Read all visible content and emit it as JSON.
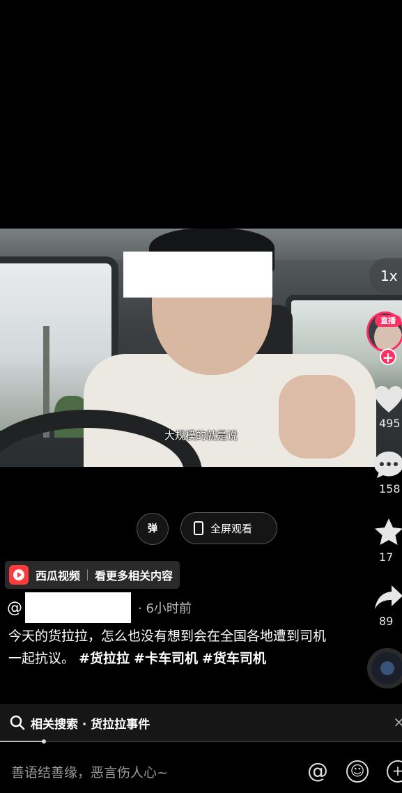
{
  "video": {
    "subtitle": "大规模的就是说",
    "speed_label": "1x"
  },
  "live": {
    "tag": "直播",
    "follow": "+"
  },
  "actions": {
    "like_count": "495",
    "comment_count": "158",
    "favorite_count": "17",
    "share_count": "89"
  },
  "controls": {
    "bullet_label": "弹",
    "fullscreen_label": "全屏观看"
  },
  "xigua": {
    "app_name": "西瓜视频",
    "more_label": "看更多相关内容"
  },
  "post": {
    "at": "@",
    "time": "· 6小时前",
    "caption_text": "今天的货拉拉，怎么也没有想到会在全国各地遭到司机一起抗议。",
    "tags": [
      "#货拉拉",
      "#卡车司机",
      "#货车司机"
    ]
  },
  "related": {
    "label": "相关搜索 · 货拉拉事件",
    "close": "×"
  },
  "progress": 0.11,
  "comment": {
    "placeholder": "善语结善缘，恶言伤人心~",
    "at_icon": "@",
    "emoji_icon": "☺",
    "add_icon": "+"
  },
  "colors": {
    "accent": "#ff2e63",
    "xigua": "#ff3b3b",
    "background": "#000000"
  },
  "icons": [
    "heart-icon",
    "comment-icon",
    "star-icon",
    "share-icon",
    "search-icon",
    "music-disc-icon"
  ]
}
